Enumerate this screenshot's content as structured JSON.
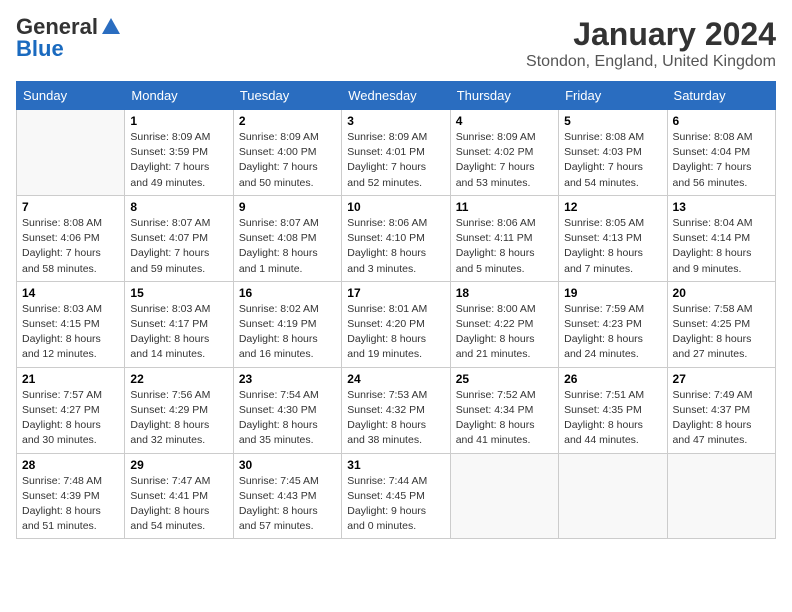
{
  "header": {
    "logo_general": "General",
    "logo_blue": "Blue",
    "title": "January 2024",
    "subtitle": "Stondon, England, United Kingdom"
  },
  "weekdays": [
    "Sunday",
    "Monday",
    "Tuesday",
    "Wednesday",
    "Thursday",
    "Friday",
    "Saturday"
  ],
  "weeks": [
    [
      {
        "day": "",
        "info": ""
      },
      {
        "day": "1",
        "info": "Sunrise: 8:09 AM\nSunset: 3:59 PM\nDaylight: 7 hours\nand 49 minutes."
      },
      {
        "day": "2",
        "info": "Sunrise: 8:09 AM\nSunset: 4:00 PM\nDaylight: 7 hours\nand 50 minutes."
      },
      {
        "day": "3",
        "info": "Sunrise: 8:09 AM\nSunset: 4:01 PM\nDaylight: 7 hours\nand 52 minutes."
      },
      {
        "day": "4",
        "info": "Sunrise: 8:09 AM\nSunset: 4:02 PM\nDaylight: 7 hours\nand 53 minutes."
      },
      {
        "day": "5",
        "info": "Sunrise: 8:08 AM\nSunset: 4:03 PM\nDaylight: 7 hours\nand 54 minutes."
      },
      {
        "day": "6",
        "info": "Sunrise: 8:08 AM\nSunset: 4:04 PM\nDaylight: 7 hours\nand 56 minutes."
      }
    ],
    [
      {
        "day": "7",
        "info": "Sunrise: 8:08 AM\nSunset: 4:06 PM\nDaylight: 7 hours\nand 58 minutes."
      },
      {
        "day": "8",
        "info": "Sunrise: 8:07 AM\nSunset: 4:07 PM\nDaylight: 7 hours\nand 59 minutes."
      },
      {
        "day": "9",
        "info": "Sunrise: 8:07 AM\nSunset: 4:08 PM\nDaylight: 8 hours\nand 1 minute."
      },
      {
        "day": "10",
        "info": "Sunrise: 8:06 AM\nSunset: 4:10 PM\nDaylight: 8 hours\nand 3 minutes."
      },
      {
        "day": "11",
        "info": "Sunrise: 8:06 AM\nSunset: 4:11 PM\nDaylight: 8 hours\nand 5 minutes."
      },
      {
        "day": "12",
        "info": "Sunrise: 8:05 AM\nSunset: 4:13 PM\nDaylight: 8 hours\nand 7 minutes."
      },
      {
        "day": "13",
        "info": "Sunrise: 8:04 AM\nSunset: 4:14 PM\nDaylight: 8 hours\nand 9 minutes."
      }
    ],
    [
      {
        "day": "14",
        "info": "Sunrise: 8:03 AM\nSunset: 4:15 PM\nDaylight: 8 hours\nand 12 minutes."
      },
      {
        "day": "15",
        "info": "Sunrise: 8:03 AM\nSunset: 4:17 PM\nDaylight: 8 hours\nand 14 minutes."
      },
      {
        "day": "16",
        "info": "Sunrise: 8:02 AM\nSunset: 4:19 PM\nDaylight: 8 hours\nand 16 minutes."
      },
      {
        "day": "17",
        "info": "Sunrise: 8:01 AM\nSunset: 4:20 PM\nDaylight: 8 hours\nand 19 minutes."
      },
      {
        "day": "18",
        "info": "Sunrise: 8:00 AM\nSunset: 4:22 PM\nDaylight: 8 hours\nand 21 minutes."
      },
      {
        "day": "19",
        "info": "Sunrise: 7:59 AM\nSunset: 4:23 PM\nDaylight: 8 hours\nand 24 minutes."
      },
      {
        "day": "20",
        "info": "Sunrise: 7:58 AM\nSunset: 4:25 PM\nDaylight: 8 hours\nand 27 minutes."
      }
    ],
    [
      {
        "day": "21",
        "info": "Sunrise: 7:57 AM\nSunset: 4:27 PM\nDaylight: 8 hours\nand 30 minutes."
      },
      {
        "day": "22",
        "info": "Sunrise: 7:56 AM\nSunset: 4:29 PM\nDaylight: 8 hours\nand 32 minutes."
      },
      {
        "day": "23",
        "info": "Sunrise: 7:54 AM\nSunset: 4:30 PM\nDaylight: 8 hours\nand 35 minutes."
      },
      {
        "day": "24",
        "info": "Sunrise: 7:53 AM\nSunset: 4:32 PM\nDaylight: 8 hours\nand 38 minutes."
      },
      {
        "day": "25",
        "info": "Sunrise: 7:52 AM\nSunset: 4:34 PM\nDaylight: 8 hours\nand 41 minutes."
      },
      {
        "day": "26",
        "info": "Sunrise: 7:51 AM\nSunset: 4:35 PM\nDaylight: 8 hours\nand 44 minutes."
      },
      {
        "day": "27",
        "info": "Sunrise: 7:49 AM\nSunset: 4:37 PM\nDaylight: 8 hours\nand 47 minutes."
      }
    ],
    [
      {
        "day": "28",
        "info": "Sunrise: 7:48 AM\nSunset: 4:39 PM\nDaylight: 8 hours\nand 51 minutes."
      },
      {
        "day": "29",
        "info": "Sunrise: 7:47 AM\nSunset: 4:41 PM\nDaylight: 8 hours\nand 54 minutes."
      },
      {
        "day": "30",
        "info": "Sunrise: 7:45 AM\nSunset: 4:43 PM\nDaylight: 8 hours\nand 57 minutes."
      },
      {
        "day": "31",
        "info": "Sunrise: 7:44 AM\nSunset: 4:45 PM\nDaylight: 9 hours\nand 0 minutes."
      },
      {
        "day": "",
        "info": ""
      },
      {
        "day": "",
        "info": ""
      },
      {
        "day": "",
        "info": ""
      }
    ]
  ]
}
